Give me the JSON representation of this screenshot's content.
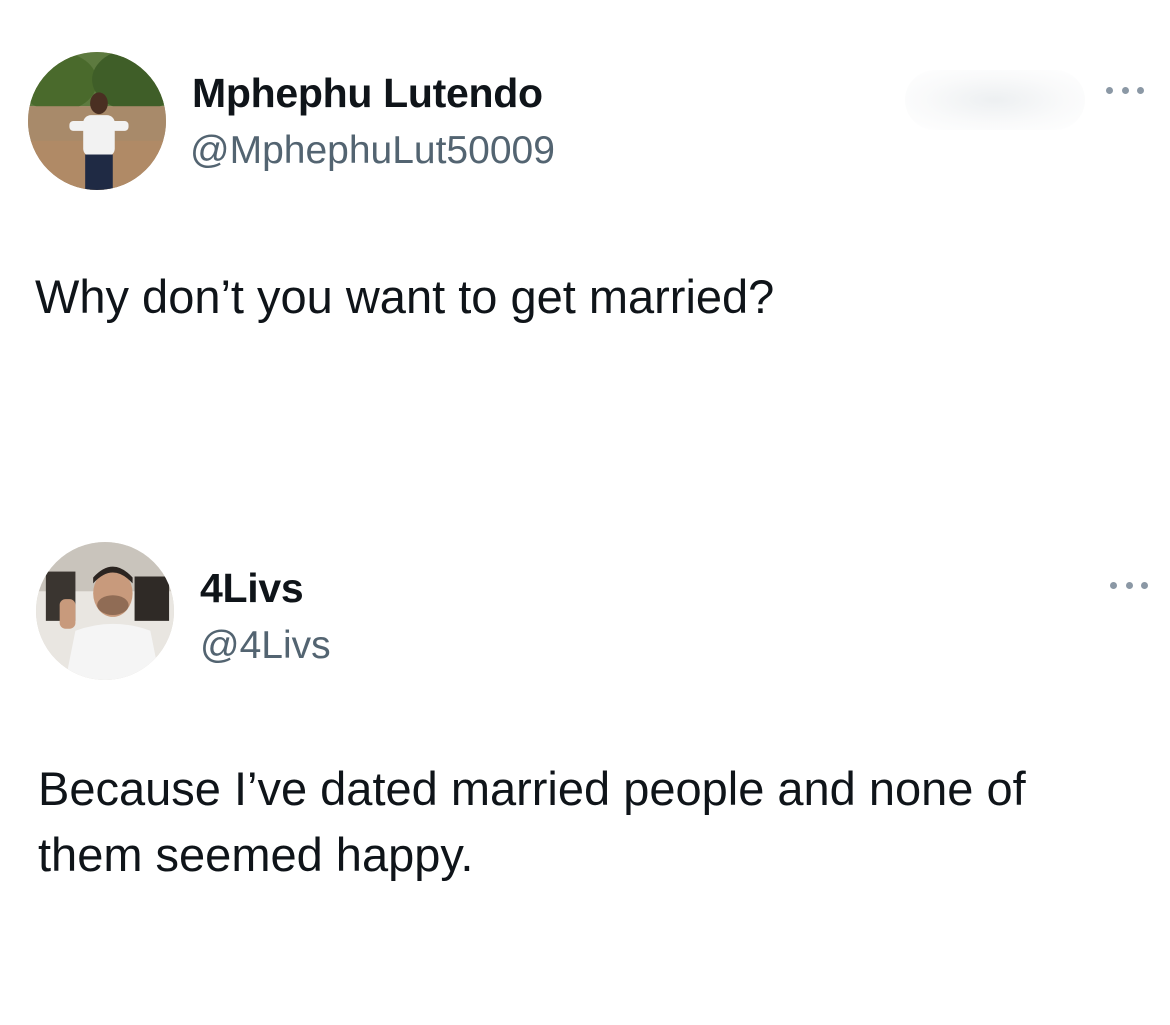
{
  "tweets": [
    {
      "display_name": "Mphephu Lutendo",
      "handle": "@MphephuLut50009",
      "text": "Why don’t you want to get married?",
      "avatar_icon": "avatar-photo-woman",
      "more_icon": "more-horizontal-icon"
    },
    {
      "display_name": "4Livs",
      "handle": "@4Livs",
      "text": "Because I’ve dated married people and none of them seemed happy.",
      "avatar_icon": "avatar-photo-man",
      "more_icon": "more-horizontal-icon"
    }
  ],
  "colors": {
    "text_primary": "#0f1419",
    "text_secondary": "#536471",
    "background": "#ffffff"
  }
}
